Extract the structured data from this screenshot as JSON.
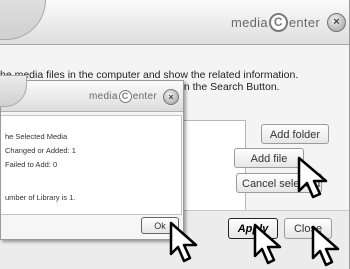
{
  "main": {
    "logo_text_1": "media",
    "logo_c": "C",
    "logo_text_2": "enter",
    "close_glyph": "×",
    "description_line1": "he media files in the computer and show the related information.",
    "description_line2": "on the Search Button.",
    "buttons": {
      "add_folder": "Add folder",
      "add_file": "Add file",
      "cancel_selected": "Cancel selected",
      "apply": "Apply",
      "close": "Close"
    }
  },
  "dialog": {
    "logo_text_1": "media",
    "logo_c": "C",
    "logo_text_2": "enter",
    "close_glyph": "×",
    "lines": [
      "he Selected Media",
      "Changed or Added: 1",
      "Failed to Add: 0",
      "umber of Library is 1."
    ],
    "ok_label": "Ok"
  }
}
